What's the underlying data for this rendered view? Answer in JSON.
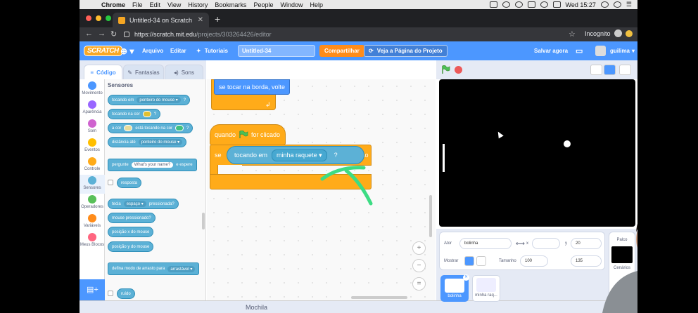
{
  "mac": {
    "app": "Chrome",
    "menu": [
      "File",
      "Edit",
      "View",
      "History",
      "Bookmarks",
      "People",
      "Window",
      "Help"
    ],
    "clock": "Wed 15:27"
  },
  "browser": {
    "tab_title": "Untitled-34 on Scratch",
    "url_host": "https://scratch.mit.edu",
    "url_path": "/projects/303264426/editor",
    "incognito_label": "Incognito"
  },
  "scratch_menu": {
    "logo": "SCRATCH",
    "file": "Arquivo",
    "edit": "Editar",
    "tutorials": "Tutoriais",
    "project_title": "Untitled-34",
    "share": "Compartilhar",
    "see_project": "Veja a Página do Projeto",
    "save": "Salvar agora",
    "user": "guilima"
  },
  "editor_tabs": {
    "code": "Código",
    "costumes": "Fantasias",
    "sounds": "Sons"
  },
  "categories": [
    {
      "label": "Movimento",
      "color": "#4c97ff"
    },
    {
      "label": "Aparência",
      "color": "#9966ff"
    },
    {
      "label": "Som",
      "color": "#cf63cf"
    },
    {
      "label": "Eventos",
      "color": "#ffbf00"
    },
    {
      "label": "Controle",
      "color": "#ffab19"
    },
    {
      "label": "Sensores",
      "color": "#5cb1d6"
    },
    {
      "label": "Operadores",
      "color": "#59c059"
    },
    {
      "label": "Variáveis",
      "color": "#ff8c1a"
    },
    {
      "label": "Meus Blocos",
      "color": "#ff6680"
    }
  ],
  "palette": {
    "section_title": "Sensores",
    "touching": "tocando em",
    "touching_opt": "ponteiro do mouse",
    "touching_color": "tocando na cor",
    "color_a": "a cor",
    "color_touching": "está tocando na cor",
    "distance": "distância até",
    "distance_opt": "ponteiro do mouse",
    "ask": "pergunte",
    "ask_value": "What's your name?",
    "ask_wait": "e espere",
    "answer": "resposta",
    "key": "tecla",
    "key_opt": "espaço",
    "key_pressed": "pressionada?",
    "mouse_down": "mouse pressionado?",
    "mouse_x": "posição x do mouse",
    "mouse_y": "posição y do mouse",
    "drag_mode": "defina modo de arrasto para",
    "drag_opt": "arrastável",
    "loudness": "ruído",
    "question_mark": "?"
  },
  "script": {
    "bounce": "se tocar na borda, volte",
    "when": "quando",
    "clicked": "for clicado",
    "if": "se",
    "then": "então",
    "touching": "tocando em",
    "touching_target": "minha raquete",
    "question_mark": "?"
  },
  "zoom": {
    "in": "+",
    "out": "−",
    "reset": "="
  },
  "backpack": "Mochila",
  "sprite_info": {
    "sprite_label": "Ator",
    "sprite_name": "bolinha",
    "x_label": "x",
    "y_label": "y",
    "y_value": "20",
    "show_label": "Mostrar",
    "size_label": "Tamanho",
    "size_value": "100",
    "direction_value": "135"
  },
  "sprites": [
    {
      "name": "bolinha",
      "selected": true
    },
    {
      "name": "minha raq...",
      "selected": false
    }
  ],
  "stage_panel": {
    "title": "Palco",
    "backdrops": "Cenários"
  }
}
